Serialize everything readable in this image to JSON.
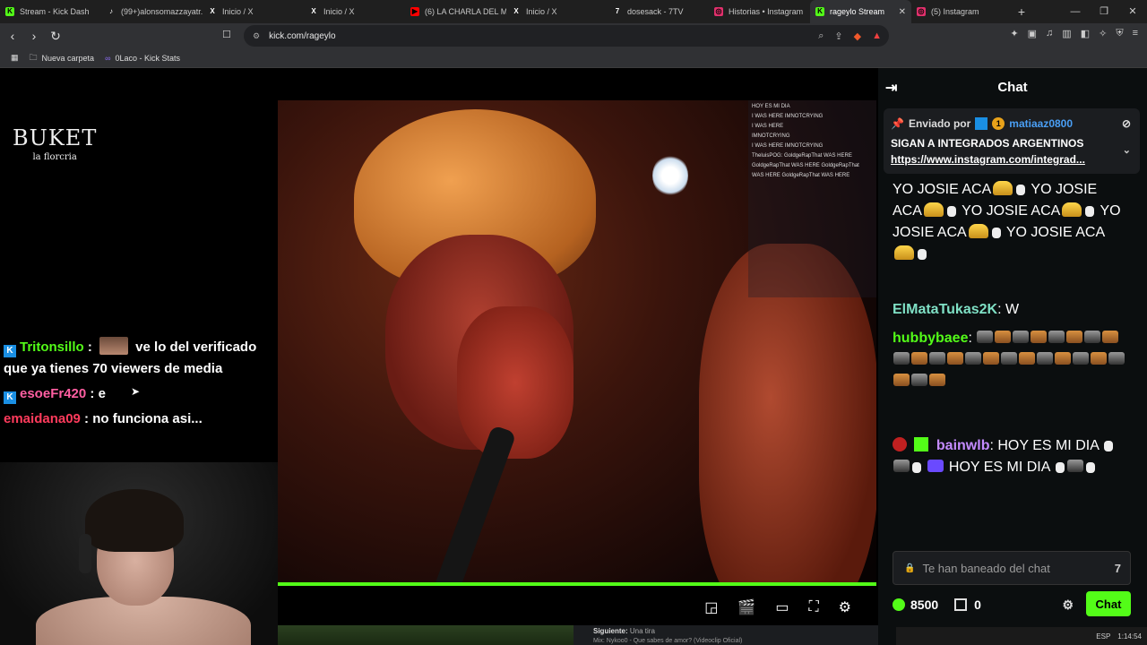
{
  "browser": {
    "tabs": [
      {
        "label": "Stream - Kick Dash",
        "fav": "K",
        "color": "#53fc18"
      },
      {
        "label": "(99+)alonsomazzayatr...",
        "fav": "♪",
        "color": "#ffffff"
      },
      {
        "label": "Inicio / X",
        "fav": "X",
        "color": "#ffffff"
      },
      {
        "label": "Inicio / X",
        "fav": "X",
        "color": "#ffffff"
      },
      {
        "label": "(6) LA CHARLA DEL M...",
        "fav": "▶",
        "color": "#ff0000"
      },
      {
        "label": "Inicio / X",
        "fav": "X",
        "color": "#ffffff"
      },
      {
        "label": "dosesack - 7TV",
        "fav": "7",
        "color": "#ffffff"
      },
      {
        "label": "Historias • Instagram",
        "fav": "◎",
        "color": "#e1306c"
      },
      {
        "label": "rageylo Stream",
        "fav": "K",
        "color": "#53fc18",
        "active": true
      },
      {
        "label": "(5) Instagram",
        "fav": "◎",
        "color": "#e1306c"
      }
    ],
    "url": "kick.com/rageylo",
    "bookmarks": [
      {
        "label": "Nueva carpeta",
        "icon": "folder-icon"
      },
      {
        "label": "0Laco - Kick Stats",
        "icon": "link-icon"
      }
    ]
  },
  "stream": {
    "logo_big": "BUKET",
    "logo_small": "la florcria",
    "overlay_lines": [
      "HOY ES MI DIA",
      "I WAS HERE IMNOTCRYING",
      "I WAS HERE",
      "IMNOTCRYING",
      "I WAS HERE IMNOTCRYING",
      "TheluisPOG: GoldgeRapThat WAS HERE",
      "GoldgeRapThat WAS HERE GoldgeRapThat",
      "WAS HERE GoldgeRapThat WAS HERE"
    ],
    "left_chat": [
      {
        "user": "Tritonsillo",
        "sep": " : ",
        "text": " ve lo del verificado que ya tienes 70 viewers de media",
        "color": "green",
        "badge": true,
        "emote": true
      },
      {
        "user": "esoeFr420",
        "sep": " : ",
        "text": "e",
        "color": "pink",
        "badge": true
      },
      {
        "user": "emaidana09",
        "sep": " : ",
        "text": "no funciona asi...",
        "color": "red",
        "badge": false
      }
    ],
    "next_label": "Siguiente:",
    "next_title": "Una tira",
    "mix_label": "Mix: Nykoo0 - Que sabes de amor? (Videoclip Oficial)"
  },
  "chat": {
    "title": "Chat",
    "pinned": {
      "sent_by": "Enviado por",
      "user": "matiaaz0800",
      "sub_months": "1",
      "message": "SIGAN A INTEGRADOS ARGENTINOS",
      "link": "https://www.instagram.com/integrad..."
    },
    "spam_text": "YO JOSIE ACA",
    "messages": [
      {
        "user": "ElMataTukas2K",
        "text": "W",
        "color": "mint"
      },
      {
        "user": "hubbybaee",
        "text": "",
        "color": "green"
      },
      {
        "user": "bainwlb",
        "text": "HOY ES MI DIA",
        "text2": "HOY ES MI DIA",
        "color": "purple"
      }
    ],
    "input_placeholder": "Te han baneado del chat",
    "points": "8500",
    "gifts": "0",
    "send_label": "Chat"
  },
  "tray": {
    "lang": "ESP",
    "time": "1:14:54"
  }
}
